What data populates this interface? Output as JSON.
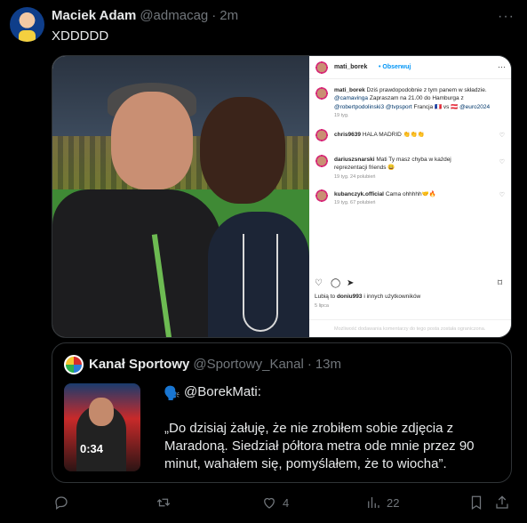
{
  "tweet": {
    "author_name": "Maciek Adam",
    "author_handle": "@admacag",
    "separator": "·",
    "time": "2m",
    "more": "···",
    "text": "XDDDDD"
  },
  "instagram": {
    "username": "mati_borek",
    "follow": "• Obserwuj",
    "more": "···",
    "caption": {
      "username": "mati_borek",
      "part1": "Dziś prawdopodobnie z tym panem w składzie.",
      "mention1": "@camavinga",
      "part2": "Zapraszam na 21.00 do Hamburga z",
      "mention2": "@robertpodolinski3",
      "mention3": "@tvpsport",
      "part3": "Francja 🇫🇷 vs 🇦🇹",
      "mention4": "@euro2024",
      "meta": "19 tyg."
    },
    "comments": [
      {
        "user": "chris9639",
        "text": "HALA MADRID 👏👏👏",
        "meta": ""
      },
      {
        "user": "dariuszsnarski",
        "text": "Mati Ty masz chyba w każdej reprezentacji friends 😀",
        "meta": "19 tyg.   24 polubień"
      },
      {
        "user": "kubanczyk.official",
        "text": "Cama ohhhhh🤝🔥",
        "meta": "19 tyg.   67 polubień"
      }
    ],
    "likes_prefix": "Lubią to",
    "likes_user": "doniu993",
    "likes_suffix": "i innych użytkowników",
    "date": "5 lipca",
    "comments_disabled": "Możliwość dodawania komentarzy do tego posta została ograniczona."
  },
  "quote": {
    "name": "Kanał Sportowy",
    "handle": "@Sportowy_Kanal",
    "separator": "·",
    "time": "13m",
    "video_duration": "0:34",
    "speaker_icon": "🗣️",
    "mention": "@BorekMati:",
    "body": "„Do dzisiaj żałuję, że nie zrobiłem sobie zdjęcia z Maradoną. Siedział półtora metra ode mnie przez 90 minut, wahałem się, pomyślałem, że to wiocha”."
  },
  "actions": {
    "reply_count": "",
    "retweet_count": "",
    "like_count": "4",
    "views_count": "22"
  },
  "icons": [
    "reply-icon",
    "retweet-icon",
    "like-icon",
    "views-icon",
    "bookmark-icon",
    "share-icon"
  ]
}
